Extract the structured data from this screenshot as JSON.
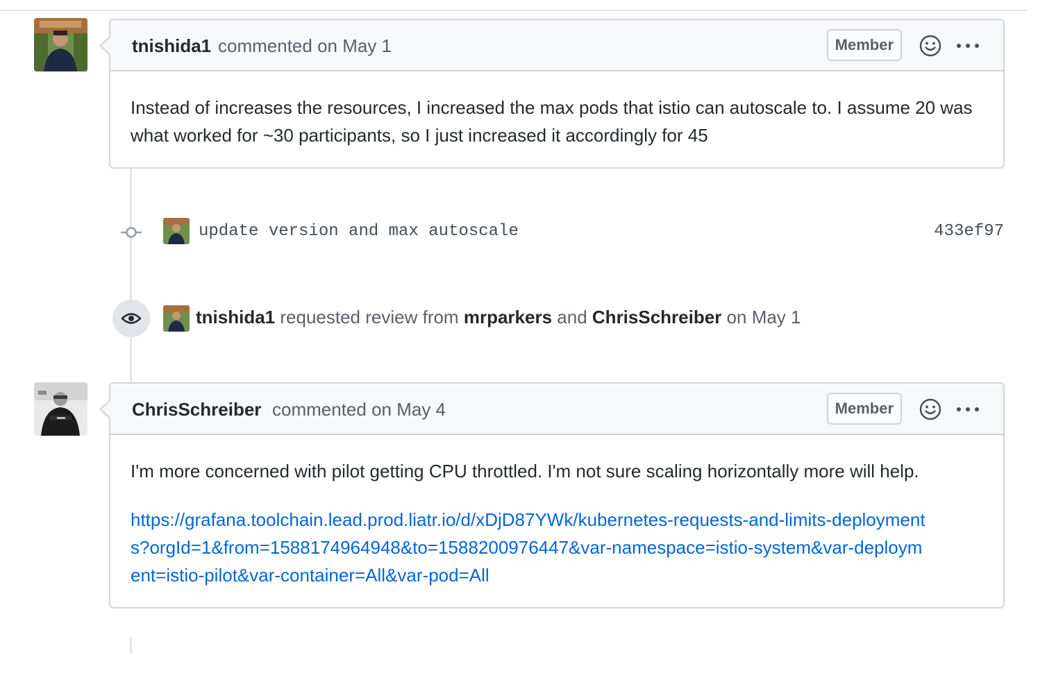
{
  "comments": [
    {
      "author": "tnishida1",
      "meta": "commented on May 1",
      "badge": "Member",
      "body": [
        "Instead of increases the resources, I increased the max pods that istio can autoscale to. I assume 20 was what worked for ~30 participants, so I just increased it accordingly for 45"
      ]
    },
    {
      "author": "ChrisSchreiber",
      "meta": "commented on May 4",
      "badge": "Member",
      "body": [
        "I'm more concerned with pilot getting CPU throttled. I'm not sure scaling horizontally more will help."
      ],
      "link": "https://grafana.toolchain.lead.prod.liatr.io/d/xDjD87YWk/kubernetes-requests-and-limits-deployments?orgId=1&from=1588174964948&to=1588200976447&var-namespace=istio-system&var-deployment=istio-pilot&var-container=All&var-pod=All"
    }
  ],
  "commit": {
    "message": "update version and max autoscale",
    "sha": "433ef97"
  },
  "review_event": {
    "actor": "tnishida1",
    "text1": "requested review from",
    "reviewer1": "mrparkers",
    "text2": "and",
    "reviewer2": "ChrisSchreiber",
    "date": "on May 1"
  },
  "icons": {
    "emoji": "smiley-icon",
    "more": "kebab-horizontal-icon",
    "commit": "git-commit-icon",
    "review": "eye-icon"
  },
  "colors": {
    "link": "#0366d6",
    "border": "#d1d5da",
    "header_bg": "#f6f8fa",
    "muted": "#586069"
  }
}
